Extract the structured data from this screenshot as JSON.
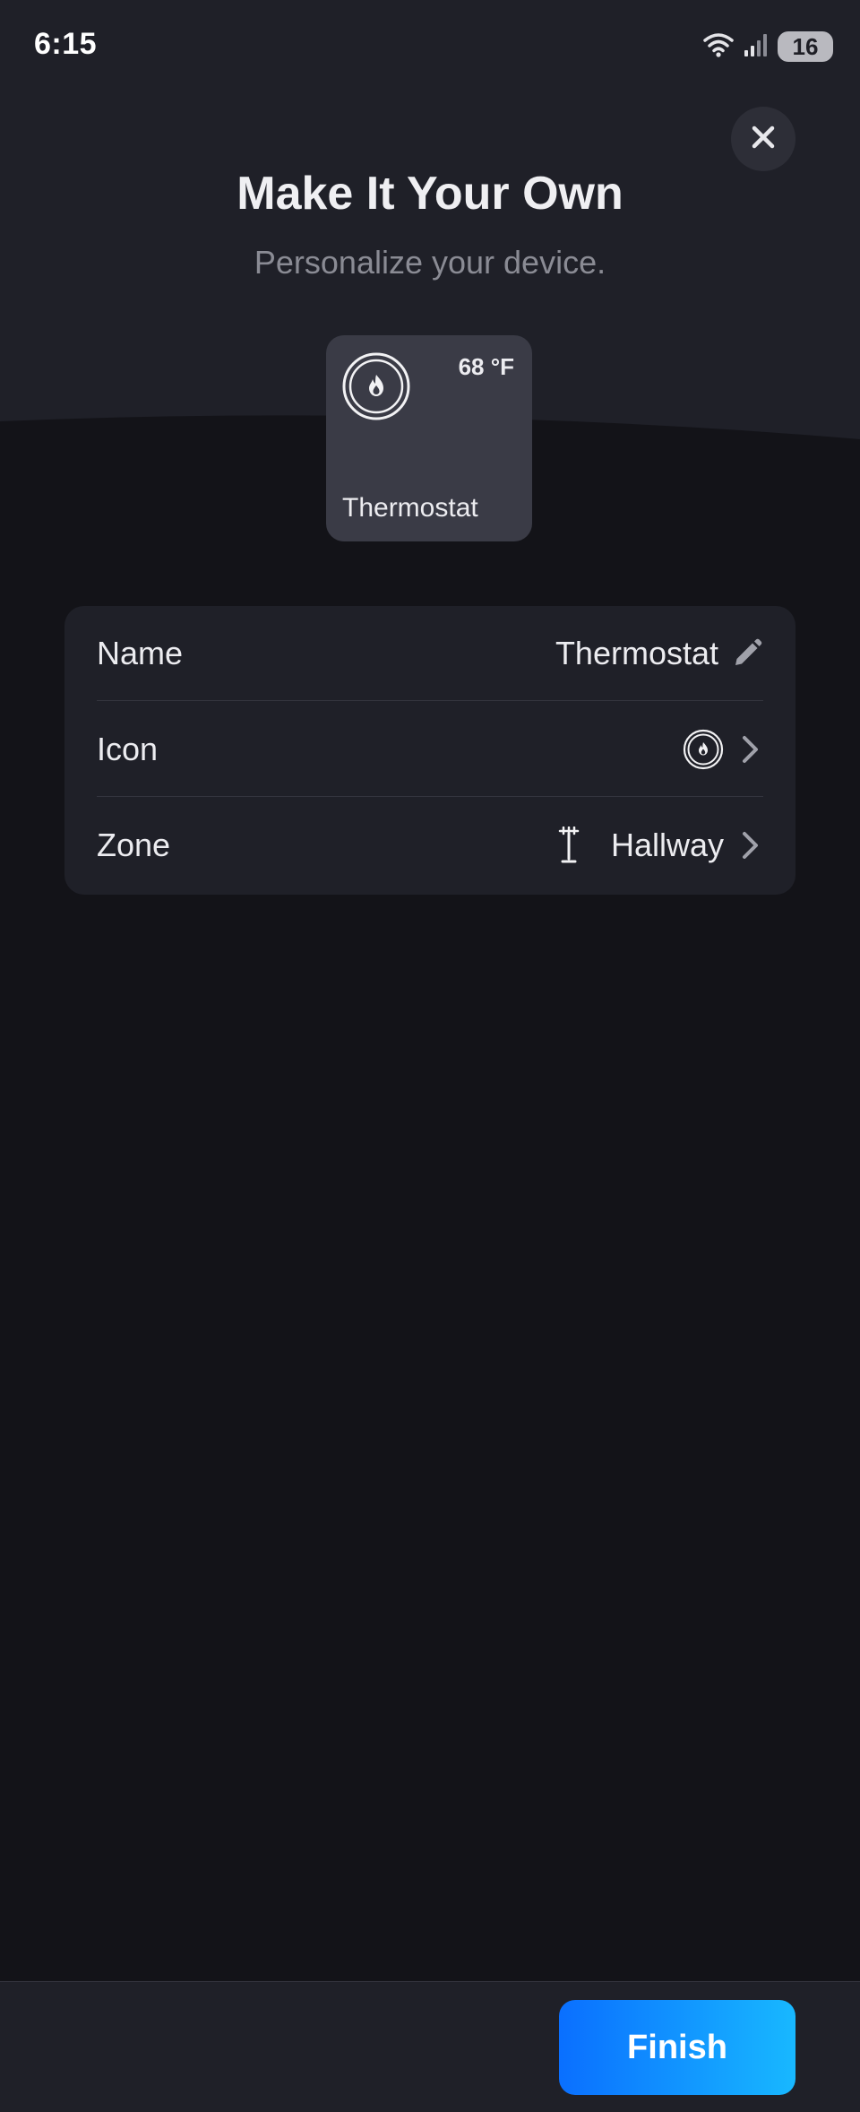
{
  "status_bar": {
    "time": "6:15",
    "battery": "16",
    "wifi_icon": "wifi-icon",
    "signal_icon": "cellular-signal-icon"
  },
  "header": {
    "title": "Make It Your Own",
    "subtitle": "Personalize your device.",
    "close_icon": "close-icon"
  },
  "device_card": {
    "icon": "thermostat-flame-icon",
    "temperature": "68 °F",
    "name": "Thermostat"
  },
  "settings": {
    "name": {
      "label": "Name",
      "value": "Thermostat",
      "action_icon": "pencil-icon"
    },
    "icon": {
      "label": "Icon",
      "value_icon": "thermostat-flame-icon",
      "action_icon": "chevron-right-icon"
    },
    "zone": {
      "label": "Zone",
      "value": "Hallway",
      "value_icon": "hallway-lamp-icon",
      "action_icon": "chevron-right-icon"
    }
  },
  "footer": {
    "finish_label": "Finish"
  },
  "colors": {
    "background": "#131318",
    "header_background": "#1f2028",
    "card": "#3a3b46",
    "accent_start": "#0a6fff",
    "accent_end": "#18b8ff"
  }
}
